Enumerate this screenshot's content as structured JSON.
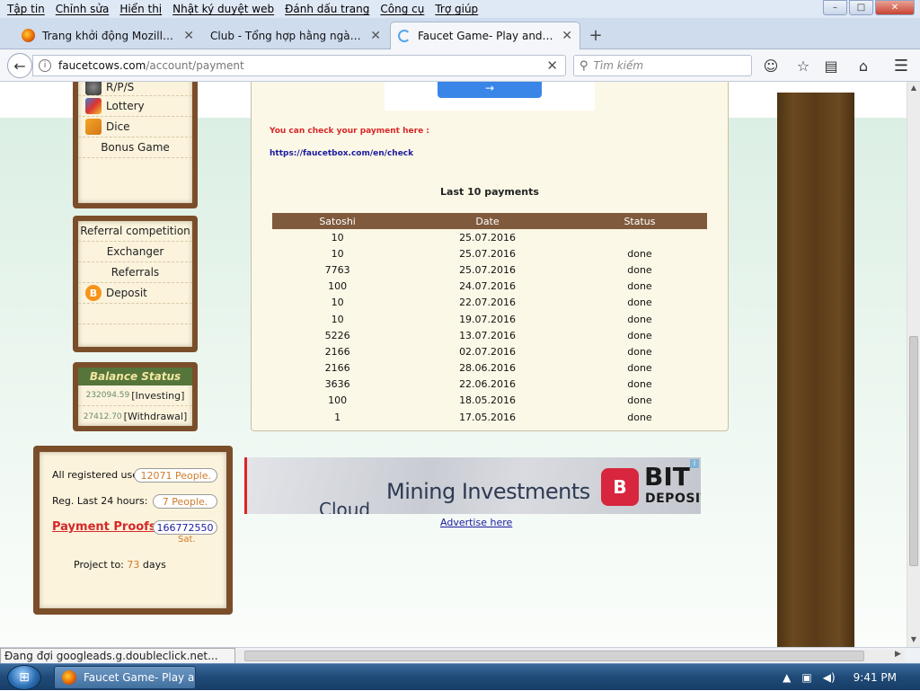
{
  "menubar": {
    "items": [
      "Tập tin",
      "Chỉnh sửa",
      "Hiển thị",
      "Nhật ký duyệt web",
      "Đánh dấu trang",
      "Công cụ",
      "Trợ giúp"
    ]
  },
  "window_controls": {
    "minimize": "–",
    "maximize": "□",
    "close": "✕"
  },
  "tabs": [
    {
      "title": "Trang khởi động Mozilla Fi..."
    },
    {
      "title": "Club - Tổng hợp hằng ngày cá..."
    },
    {
      "title": "Faucet Game- Play and ear..."
    }
  ],
  "address": {
    "host": "faucetcows.com",
    "path": "/account/payment"
  },
  "search": {
    "placeholder": "Tìm kiếm"
  },
  "sidebar": {
    "games": [
      "R/P/S",
      "Lottery",
      "Dice",
      "Bonus Game"
    ],
    "links": [
      "Referral competition",
      "Exchanger",
      "Referrals",
      "Deposit"
    ],
    "balance": {
      "title": "Balance Status",
      "investing_value": "232094.59",
      "investing_label": "[Investing]",
      "withdrawal_value": "27412.70",
      "withdrawal_label": "[Withdrawal]"
    }
  },
  "main": {
    "check_text": "You can check your payment here :",
    "check_link": "https://faucetbox.com/en/check",
    "payments_title": "Last 10 payments",
    "table": {
      "columns": [
        "Satoshi",
        "Date",
        "Status"
      ],
      "rows": [
        [
          "10",
          "25.07.2016",
          ""
        ],
        [
          "10",
          "25.07.2016",
          "done"
        ],
        [
          "7763",
          "25.07.2016",
          "done"
        ],
        [
          "100",
          "24.07.2016",
          "done"
        ],
        [
          "10",
          "22.07.2016",
          "done"
        ],
        [
          "10",
          "19.07.2016",
          "done"
        ],
        [
          "5226",
          "13.07.2016",
          "done"
        ],
        [
          "2166",
          "02.07.2016",
          "done"
        ],
        [
          "2166",
          "28.06.2016",
          "done"
        ],
        [
          "3636",
          "22.06.2016",
          "done"
        ],
        [
          "100",
          "18.05.2016",
          "done"
        ],
        [
          "1",
          "17.05.2016",
          "done"
        ]
      ]
    }
  },
  "stats": {
    "registered_label": "All registered users:",
    "registered_value": "12071 People.",
    "last24_label": "Reg. Last 24 hours:",
    "last24_value": "7 People.",
    "proofs_label": "Payment Proofs",
    "proofs_value": "166772550",
    "proofs_unit": "Sat.",
    "project_label": "Project to:",
    "project_days": "73",
    "project_unit": "days"
  },
  "ad": {
    "cloud": "Cloud",
    "headline": "Mining Investments",
    "brand_top": "BIT",
    "brand_bottom": "DEPOSIT",
    "advertise": "Advertise here",
    "choice": "i"
  },
  "status": {
    "text": "Đang đợi googleads.g.doubleclick.net..."
  },
  "taskbar": {
    "button": "Faucet Game- Play a...",
    "time": "9:41 PM"
  },
  "colors": {
    "wood": "#7b4e2a",
    "panel": "#fbf3dc",
    "accent_red": "#d62828",
    "link_blue": "#1a1aa0",
    "orange": "#d07b2a"
  }
}
